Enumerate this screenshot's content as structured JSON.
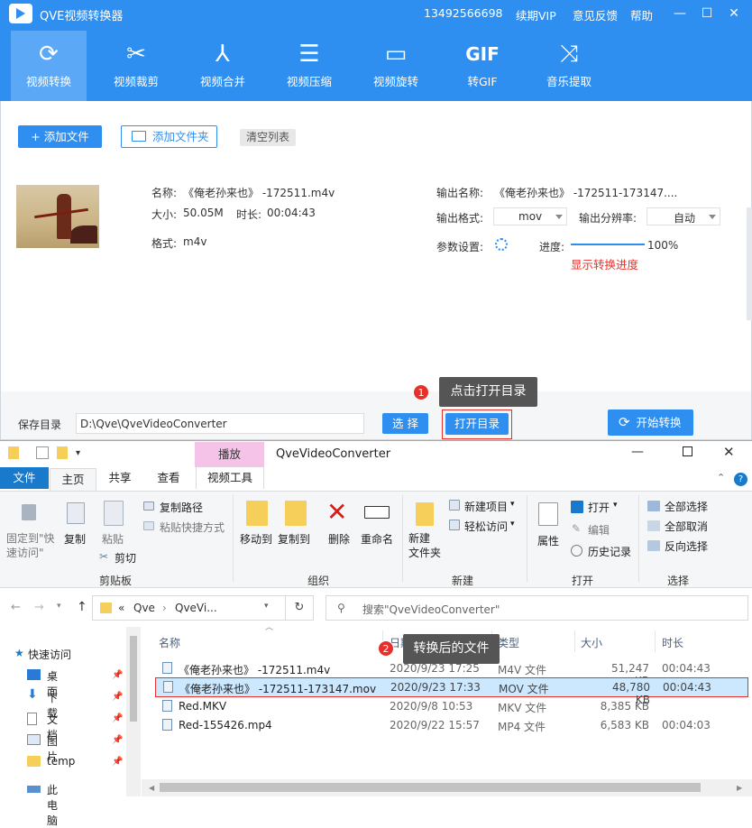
{
  "app": {
    "title": "QVE视频转换器",
    "phone": "13492566698",
    "links": [
      "续期VIP",
      "意见反馈",
      "帮助"
    ],
    "win": {
      "min": "—",
      "max": "☐",
      "close": "✕"
    },
    "tools": [
      {
        "label": "视频转换",
        "icon": "⟳"
      },
      {
        "label": "视频裁剪",
        "icon": "✂"
      },
      {
        "label": "视频合并",
        "icon": "⅄"
      },
      {
        "label": "视频压缩",
        "icon": "☰"
      },
      {
        "label": "视频旋转",
        "icon": "▭"
      },
      {
        "label": "转GIF",
        "icon": "GIF"
      },
      {
        "label": "音乐提取",
        "icon": "⤨"
      }
    ],
    "add_file": "+ 添加文件",
    "add_folder": "添加文件夹",
    "clear": "清空列表",
    "file": {
      "name_label": "名称:",
      "name": "《俺老孙来也》 -172511.m4v",
      "size_label": "大小:",
      "size": "50.05M",
      "dur_label": "时长:",
      "dur": "00:04:43",
      "fmt_label": "格式:",
      "fmt": "m4v",
      "out_name_label": "输出名称:",
      "out_name": "《俺老孙来也》 -172511-173147....",
      "out_fmt_label": "输出格式:",
      "out_fmt": "mov",
      "out_res_label": "输出分辨率:",
      "out_res": "自动",
      "param_label": "参数设置:",
      "progress_label": "进度:",
      "progress": "100%",
      "progress_value": 1.0,
      "show_progress": "显示转换进度"
    },
    "save_label": "保存目录",
    "save_path": "D:\\Qve\\QveVideoConverter",
    "choose": "选 择",
    "open_dir": "打开目录",
    "start": "开始转换",
    "callout1": "点击打开目录",
    "callout1_num": "1"
  },
  "explorer": {
    "title": "QveVideoConverter",
    "context_tab": "播放",
    "tabs": [
      "文件",
      "主页",
      "共享",
      "查看",
      "视频工具"
    ],
    "ribbon": {
      "pin": "固定到\"快速访问\"",
      "copy": "复制",
      "paste": "粘贴",
      "copy_path": "复制路径",
      "paste_shortcut": "粘贴快捷方式",
      "cut": "剪切",
      "group_clipboard": "剪贴板",
      "move_to": "移动到",
      "copy_to": "复制到",
      "delete": "删除",
      "rename": "重命名",
      "group_organize": "组织",
      "new_folder": "新建\n文件夹",
      "new_item": "新建项目",
      "easy_access": "轻松访问",
      "group_new": "新建",
      "properties": "属性",
      "open": "打开",
      "edit": "编辑",
      "history": "历史记录",
      "group_open": "打开",
      "select_all": "全部选择",
      "select_none": "全部取消",
      "invert": "反向选择",
      "group_select": "选择"
    },
    "address": [
      "«",
      "Qve",
      "›",
      "QveVi..."
    ],
    "search_placeholder": "搜索\"QveVideoConverter\"",
    "nav": [
      "快速访问",
      "桌面",
      "下载",
      "文档",
      "图片",
      "temp",
      "此电脑"
    ],
    "columns": [
      "名称",
      "日期",
      "类型",
      "大小",
      "时长"
    ],
    "rows": [
      {
        "name": "《俺老孙来也》 -172511.m4v",
        "date": "2020/9/23 17:25",
        "type": "M4V 文件",
        "size": "51,247 KB",
        "dur": "00:04:43"
      },
      {
        "name": "《俺老孙来也》 -172511-173147.mov",
        "date": "2020/9/23 17:33",
        "type": "MOV 文件",
        "size": "48,780 KB",
        "dur": "00:04:43"
      },
      {
        "name": "Red.MKV",
        "date": "2020/9/8 10:53",
        "type": "MKV 文件",
        "size": "8,385 KB",
        "dur": ""
      },
      {
        "name": "Red-155426.mp4",
        "date": "2020/9/22 15:57",
        "type": "MP4 文件",
        "size": "6,583 KB",
        "dur": "00:04:03"
      }
    ],
    "callout2": "转换后的文件",
    "callout2_num": "2"
  }
}
